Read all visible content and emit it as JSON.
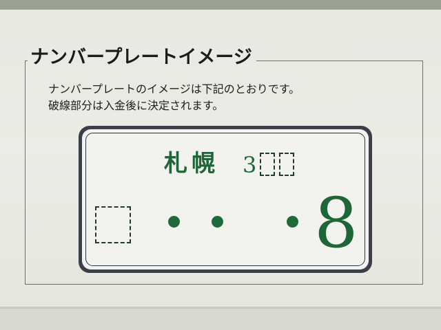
{
  "section": {
    "title": "ナンバープレートイメージ"
  },
  "description": {
    "line1": "ナンバープレートのイメージは下記のとおりです。",
    "line2": "破線部分は入金後に決定されます。"
  },
  "plate": {
    "region": "札幌",
    "class_prefix": "3",
    "class_hidden_slots": 2,
    "hiragana_hidden": true,
    "serial_placeholder_dots": 3,
    "serial_visible_digit": "8",
    "text_color": "#1e6638",
    "plate_color": "#f2f3ef",
    "frame_color": "#3b3f4a"
  }
}
